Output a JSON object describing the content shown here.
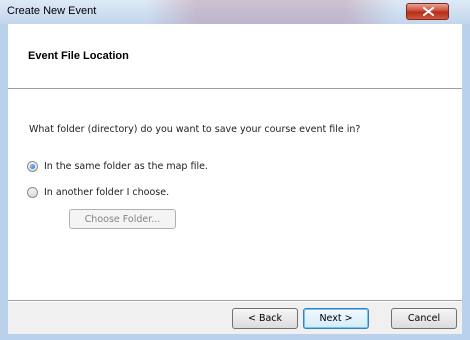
{
  "window": {
    "title": "Create New Event",
    "close_glyph": "×"
  },
  "header": {
    "title": "Event File Location"
  },
  "main": {
    "question": "What folder (directory) do you want to save your course event file in?",
    "options": [
      {
        "label": "In the same folder as the map file.",
        "checked": true
      },
      {
        "label": "In another folder I choose.",
        "checked": false
      }
    ],
    "choose_folder_label": "Choose Folder..."
  },
  "footer": {
    "back_label": "< Back",
    "next_label": "Next >",
    "cancel_label": "Cancel"
  }
}
